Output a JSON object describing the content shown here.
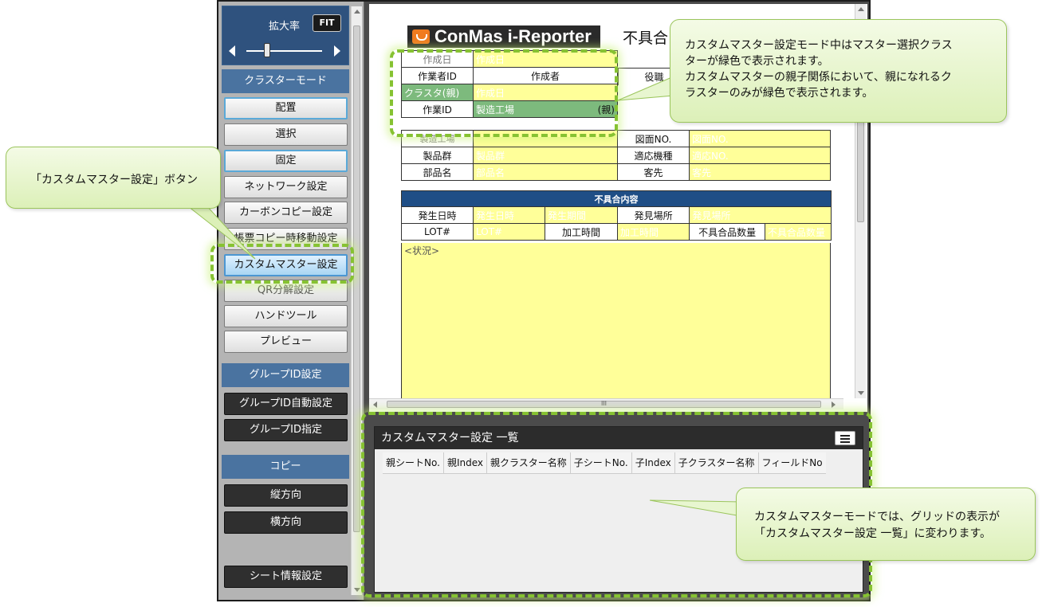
{
  "sidebar": {
    "zoom_label": "拡大率",
    "fit_label": "FIT",
    "cluster_mode_header": "クラスターモード",
    "buttons": [
      "配置",
      "選択",
      "固定",
      "ネットワーク設定",
      "カーボンコピー設定",
      "帳票コピー時移動設定",
      "カスタムマスター設定",
      "QR分解設定",
      "ハンドツール",
      "プレビュー"
    ],
    "group_header": "グループID設定",
    "group_buttons": [
      "グループID自動設定",
      "グループID指定"
    ],
    "copy_header": "コピー",
    "copy_buttons": [
      "縦方向",
      "横方向"
    ],
    "sheet_info_label": "シート情報設定"
  },
  "document": {
    "logo": "ConMas i-Reporter",
    "title_partial": "不具合",
    "rows": {
      "created_date_label": "作成日",
      "created_date_value": "作成日",
      "worker_id": "作業者ID",
      "creator": "作成者",
      "role": "役職",
      "cluster_parent": "クラスタ(親)",
      "cluster_parent_value": "作成日",
      "work_id": "作業ID",
      "factory": "製造工場",
      "parent_tag": "(親)",
      "factory_label": "製造工場",
      "drawing_no_label": "図面NO.",
      "drawing_no_value": "図面NO.",
      "product_group_label": "製品群",
      "product_group_value": "製品群",
      "model_label": "適応機種",
      "model_value": "適応NO.",
      "part_name_label": "部品名",
      "part_name_value": "部品名",
      "customer_label": "客先",
      "customer_value": "客先"
    },
    "defect_section": {
      "header": "不具合内容",
      "occur_datetime_label": "発生日時",
      "occur_datetime_value": "発生日時",
      "occur_date2_value": "発生期間",
      "found_place_label": "発見場所",
      "found_place_value": "発見場所",
      "lot_label": "LOT#",
      "lot_value": "LOT#",
      "process_time_label": "加工時間",
      "process_time_value": "加工時間",
      "defect_qty_label": "不具合品数量",
      "defect_qty_value": "不具合品数量",
      "status_label": "<状況>"
    },
    "hscroll_grip": "III"
  },
  "list_panel": {
    "title": "カスタムマスター設定 一覧",
    "columns": [
      "親シートNo.",
      "親Index",
      "親クラスター名称",
      "子シートNo.",
      "子Index",
      "子クラスター名称",
      "フィールドNo"
    ]
  },
  "callouts": {
    "button_callout": "「カスタムマスター設定」ボタン",
    "cluster_callout_line1": "カスタムマスター設定モード中はマスター選択クラス",
    "cluster_callout_line2": "ターが緑色で表示されます。",
    "cluster_callout_line3": "カスタムマスターの親子関係において、親になれるク",
    "cluster_callout_line4": "ラスターのみが緑色で表示されます。",
    "grid_callout_line1": "カスタムマスターモードでは、グリッドの表示が",
    "grid_callout_line2": "「カスタムマスター設定 一覧」に変わります。"
  },
  "colors": {
    "highlight_green": "#86c232",
    "cluster_yellow": "#ffff99",
    "cluster_green": "#7dba7d",
    "section_blue": "#4a73a0",
    "defect_header_blue": "#1f4e86"
  }
}
